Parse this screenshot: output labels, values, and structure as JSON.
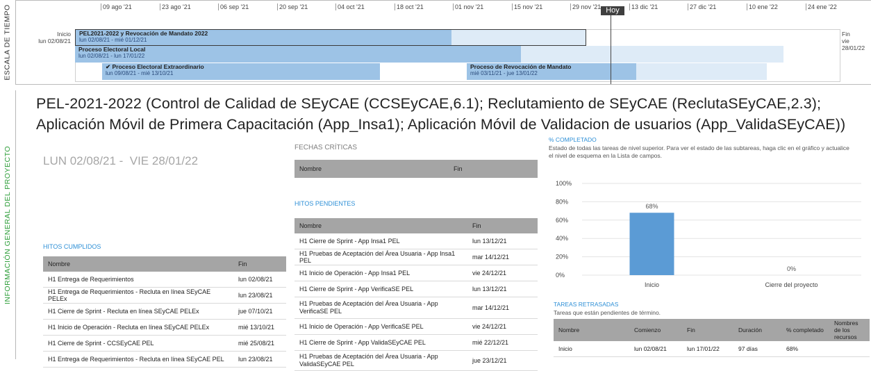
{
  "timeline": {
    "side_label": "ESCALA DE TIEMPO",
    "today_label": "Hoy",
    "ticks": [
      "09 ago '21",
      "23 ago '21",
      "06 sep '21",
      "20 sep '21",
      "04 oct '21",
      "18 oct '21",
      "01 nov '21",
      "15 nov '21",
      "29 nov '21",
      "13 dic '21",
      "27 dic '21",
      "10 ene '22",
      "24 ene '22"
    ],
    "start": {
      "label": "Inicio",
      "date": "lun 02/08/21"
    },
    "end": {
      "label": "Fin",
      "date": "vie 28/01/22"
    },
    "bars": [
      {
        "name": "PEL2021-2022 y Revocación de Mandato 2022",
        "dates": "lun 02/08/21 - mié 01/12/21"
      },
      {
        "name": "Proceso Electoral Local",
        "dates": "lun 02/08/21 - lun 17/01/22"
      },
      {
        "name": "✔ Proceso Electoral Extraordinario",
        "dates": "lun 09/08/21 - mié 13/10/21"
      },
      {
        "name": "Proceso de Revocación de Mandato",
        "dates": "mié 03/11/21 - jue 13/01/22"
      }
    ]
  },
  "side_label_main": "INFORMACIÓN GENERAL DEL PROYECTO",
  "title_line1": "PEL-2021-2022 (Control de Calidad de SEyCAE (CCSEyCAE,6.1); Reclutamiento de SEyCAE (ReclutaSEyCAE,2.3);",
  "title_line2": "Aplicación Móvil de Primera Capacitación (App_Insa1); Aplicación Móvil de Validacion de usuarios (App_ValidaSEyCAE))",
  "project_dates": "LUN 02/08/21 -  VIE 28/01/22",
  "critical_dates": {
    "title": "FECHAS CRÍTICAS",
    "col_name": "Nombre",
    "col_end": "Fin"
  },
  "pending": {
    "title": "HITOS PENDIENTES",
    "col_name": "Nombre",
    "col_end": "Fin",
    "rows": [
      [
        "H1 Cierre de Sprint - App Insa1 PEL",
        "lun 13/12/21"
      ],
      [
        "H1 Pruebas de Aceptación del Área Usuaria - App Insa1 PEL",
        "mar 14/12/21"
      ],
      [
        "H1 Inicio de Operación - App Insa1 PEL",
        "vie 24/12/21"
      ],
      [
        "H1 Cierre de Sprint - App VerificaSE PEL",
        "lun 13/12/21"
      ],
      [
        "H1 Pruebas de Aceptación del Área Usuaria - App VerificaSE PEL",
        "mar 14/12/21"
      ],
      [
        "H1 Inicio de Operación - App VerificaSE PEL",
        "vie 24/12/21"
      ],
      [
        "H1 Cierre de Sprint - App ValidaSEyCAE PEL",
        "mié 22/12/21"
      ],
      [
        "H1 Pruebas de Aceptación del Área Usuaria - App ValidaSEyCAE PEL",
        "jue 23/12/21"
      ]
    ]
  },
  "completed": {
    "title": "HITOS CUMPLIDOS",
    "col_name": "Nombre",
    "col_end": "Fin",
    "rows": [
      [
        "H1 Entrega de Requerimientos",
        "lun 02/08/21"
      ],
      [
        "H1 Entrega de Requerimientos - Recluta en línea SEyCAE PELEx",
        "lun 23/08/21"
      ],
      [
        "H1 Cierre de Sprint - Recluta en línea SEyCAE PELEx",
        "jue 07/10/21"
      ],
      [
        "H1 Inicio de Operación - Recluta en línea SEyCAE PELEx",
        "mié 13/10/21"
      ],
      [
        "H1 Cierre de Sprint - CCSEyCAE PEL",
        "mié 25/08/21"
      ],
      [
        "H1 Entrega de Requerimientos - Recluta en línea SEyCAE PEL",
        "lun 23/08/21"
      ]
    ]
  },
  "pct": {
    "title": "% COMPLETADO",
    "desc": "Estado de todas las tareas de nivel superior. Para ver el estado de las subtareas, haga clic en el gráfico y actualice el nivel de esquema en la Lista de campos."
  },
  "chart_data": {
    "type": "bar",
    "categories": [
      "Inicio",
      "Cierre del proyecto"
    ],
    "values": [
      68,
      0
    ],
    "data_labels": [
      "68%",
      "0%"
    ],
    "yticks": [
      "100%",
      "80%",
      "60%",
      "40%",
      "20%",
      "0%"
    ],
    "ylim": [
      0,
      100
    ],
    "color": "#5b9bd5"
  },
  "late": {
    "title": "TAREAS RETRASADAS",
    "desc": "Tareas que están pendientes de término.",
    "cols": [
      "Nombre",
      "Comienzo",
      "Fin",
      "Duración",
      "% completado",
      "Nombres de los recursos"
    ],
    "row": [
      "Inicio",
      "lun 02/08/21",
      "lun 17/01/22",
      "97 días",
      "68%",
      ""
    ]
  }
}
